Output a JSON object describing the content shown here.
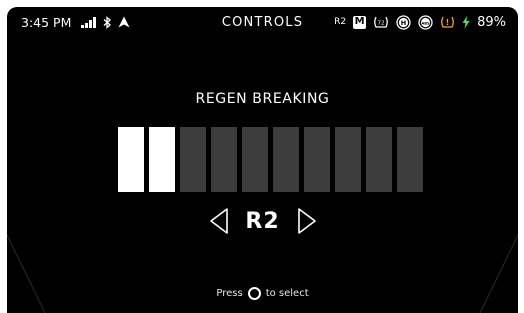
{
  "status_bar": {
    "time": "3:45 PM",
    "title": "CONTROLS",
    "regen_indicator": "R2",
    "mode_badge": "M",
    "battery": "89%",
    "icons": [
      "signal-icon",
      "bluetooth-icon",
      "navigation-icon",
      "tire-pressure-icon",
      "hold-icon",
      "abs-icon",
      "warning-icon",
      "charging-icon"
    ]
  },
  "screen": {
    "title": "REGEN BREAKING",
    "level": {
      "current": 2,
      "max": 10
    },
    "selected_value": "R2",
    "hint": {
      "before": "Press",
      "after": "to select"
    }
  },
  "colors": {
    "background": "#000000",
    "active_segment": "#ffffff",
    "inactive_segment": "#3c3c3c",
    "warning": "#f5a623",
    "charging": "#4cd964"
  }
}
